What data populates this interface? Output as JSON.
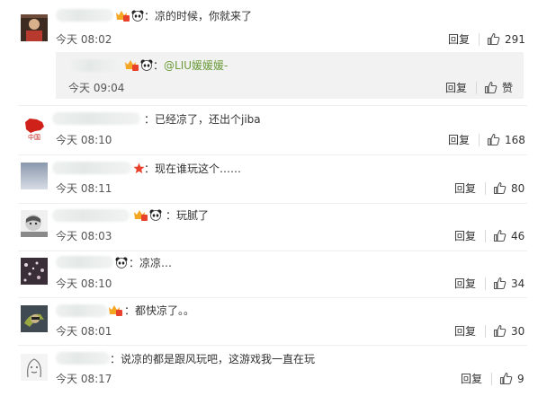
{
  "comments": [
    {
      "text": "凉的时候，你就来了",
      "time": "今天 08:02",
      "reply": "回复",
      "likes": "291"
    },
    {
      "text": "已经凉了，还出个jiba",
      "time": "今天 08:10",
      "reply": "回复",
      "likes": "168"
    },
    {
      "text": "现在谁玩这个……",
      "time": "今天 08:11",
      "reply": "回复",
      "likes": "80"
    },
    {
      "text": "玩腻了",
      "time": "今天 08:03",
      "reply": "回复",
      "likes": "46"
    },
    {
      "text": "凉凉…",
      "time": "今天 08:10",
      "reply": "回复",
      "likes": "34"
    },
    {
      "text": "都快凉了。。",
      "time": "今天 08:01",
      "reply": "回复",
      "likes": "30"
    },
    {
      "text": "说凉的都是跟风玩吧，这游戏我一直在玩",
      "time": "今天 08:17",
      "reply": "回复",
      "likes": "9"
    }
  ],
  "sub_reply": {
    "mention": "@LIU媛媛媛-",
    "time": "今天 09:04",
    "reply": "回复",
    "like_label": "赞"
  },
  "colon": "：",
  "avatar_text": "中国",
  "icons": {
    "thumb": "thumbs-up-icon",
    "vip": "vip-badge-icon",
    "panda": "panda-emoji-icon",
    "star": "star-badge-icon"
  }
}
